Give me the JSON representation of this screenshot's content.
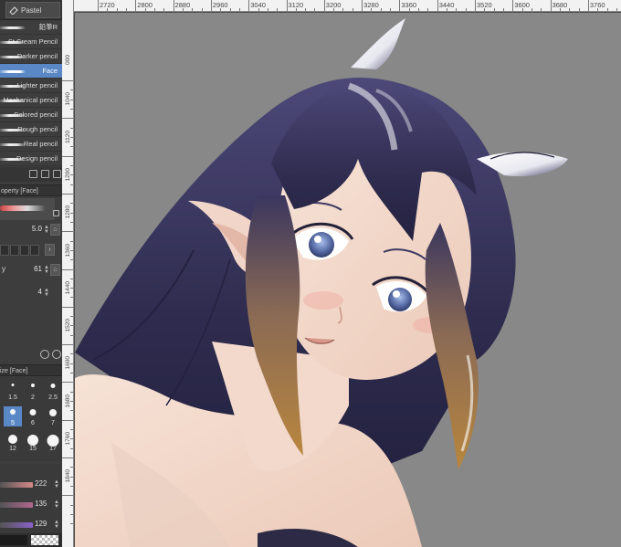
{
  "brush_tabs": {
    "pastel_label": "Pastel"
  },
  "brush_list": {
    "items": [
      {
        "label": "鉛筆R",
        "selected": false
      },
      {
        "label": "St Cream Pencil",
        "selected": false
      },
      {
        "label": "Darker pencil",
        "selected": false
      },
      {
        "label": "Face",
        "selected": true
      },
      {
        "label": "Lighter pencil",
        "selected": false
      },
      {
        "label": "Mechanical pencil",
        "selected": false
      },
      {
        "label": "Colored pencil",
        "selected": false
      },
      {
        "label": "Rough pencil",
        "selected": false
      },
      {
        "label": "Real pencil",
        "selected": false
      },
      {
        "label": "Design pencil",
        "selected": false
      }
    ]
  },
  "tool_property": {
    "header": "operty [Face]",
    "brush_size": "5.0",
    "opacity_label": "y",
    "opacity": "61",
    "anti_alias": "4"
  },
  "brush_size_palette": {
    "header": "ize [Face]",
    "sizes": [
      "1.5",
      "2",
      "2.5",
      "5",
      "6",
      "7",
      "12",
      "15",
      "17"
    ],
    "selected": "5"
  },
  "color_sliders": {
    "values": [
      "222",
      "135",
      "129"
    ],
    "bar_colors": [
      "#d88a8a",
      "#b0678f",
      "#8a62c8"
    ]
  },
  "h_ruler": {
    "labels": [
      "2720",
      "2800",
      "2880",
      "2960",
      "3040",
      "3120",
      "3200",
      "3280",
      "3360",
      "3440",
      "3520",
      "3600",
      "3680",
      "3760"
    ]
  },
  "v_ruler": {
    "labels": [
      "000",
      "1040",
      "1120",
      "1200",
      "1280",
      "1360",
      "1440",
      "1520",
      "1600",
      "1680",
      "1760",
      "1840"
    ]
  },
  "artwork": {
    "hair_color": "#3d3a63",
    "hair_tip_color": "#a87a4a",
    "skin_color": "#f3dccf",
    "eye_color": "#5a6ea8",
    "background_gray": "#888888"
  }
}
